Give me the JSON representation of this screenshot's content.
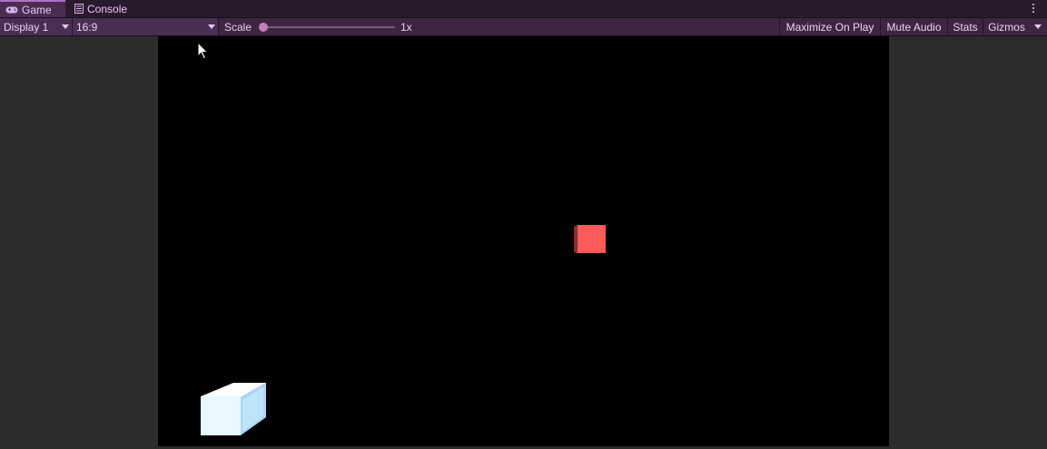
{
  "tabs": [
    {
      "label": "Game",
      "icon": "gamepad-icon",
      "active": true
    },
    {
      "label": "Console",
      "icon": "console-icon",
      "active": false
    }
  ],
  "toolbar": {
    "display_label": "Display 1",
    "aspect_label": "16:9",
    "scale_label": "Scale",
    "scale_value": "1x",
    "scale_level": 0,
    "maximize_label": "Maximize On Play",
    "mute_label": "Mute Audio",
    "stats_label": "Stats",
    "gizmos_label": "Gizmos"
  },
  "scene": {
    "objects": [
      {
        "name": "red-cube",
        "color": "#ff5a5a"
      },
      {
        "name": "ice-block",
        "color": "#e6f8ff"
      }
    ]
  },
  "colors": {
    "accent": "#b070c8",
    "toolbar_bg": "#3d2642",
    "tab_bg": "#2a1a2e",
    "view_bg": "#000000"
  }
}
